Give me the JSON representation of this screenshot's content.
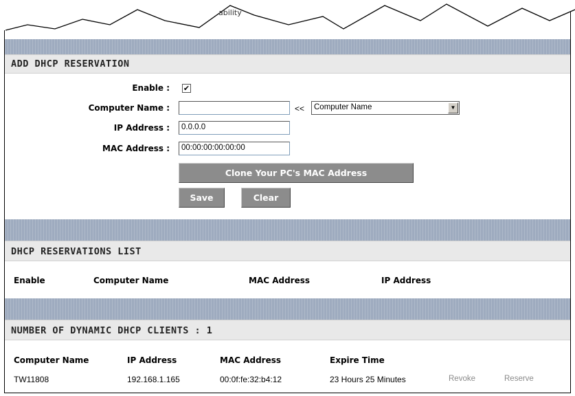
{
  "torn_header_text": "ability",
  "add_reservation": {
    "title": "ADD DHCP RESERVATION",
    "enable_label": "Enable :",
    "enable_checked": true,
    "computer_name_label": "Computer Name :",
    "computer_name_value": "",
    "transfer_symbol": "<<",
    "computer_name_select": "Computer Name",
    "ip_label": "IP Address :",
    "ip_value": "0.0.0.0",
    "mac_label": "MAC Address :",
    "mac_value": "00:00:00:00:00:00",
    "clone_button": "Clone Your PC's MAC Address",
    "save_button": "Save",
    "clear_button": "Clear"
  },
  "reservations_list": {
    "title": "DHCP RESERVATIONS LIST",
    "columns": [
      "Enable",
      "Computer Name",
      "MAC Address",
      "IP Address"
    ]
  },
  "dynamic_clients": {
    "title": "NUMBER OF DYNAMIC DHCP CLIENTS : 1",
    "columns": [
      "Computer Name",
      "IP Address",
      "MAC Address",
      "Expire Time"
    ],
    "rows": [
      {
        "computer_name": "TW11808",
        "ip": "192.168.1.165",
        "mac": "00:0f:fe:32:b4:12",
        "expire": "23 Hours 25 Minutes",
        "revoke": "Revoke",
        "reserve": "Reserve"
      }
    ]
  },
  "colors": {
    "stripe": "#9eabbf",
    "section_head": "#e9e9e9",
    "button": "#8c8c8c"
  }
}
